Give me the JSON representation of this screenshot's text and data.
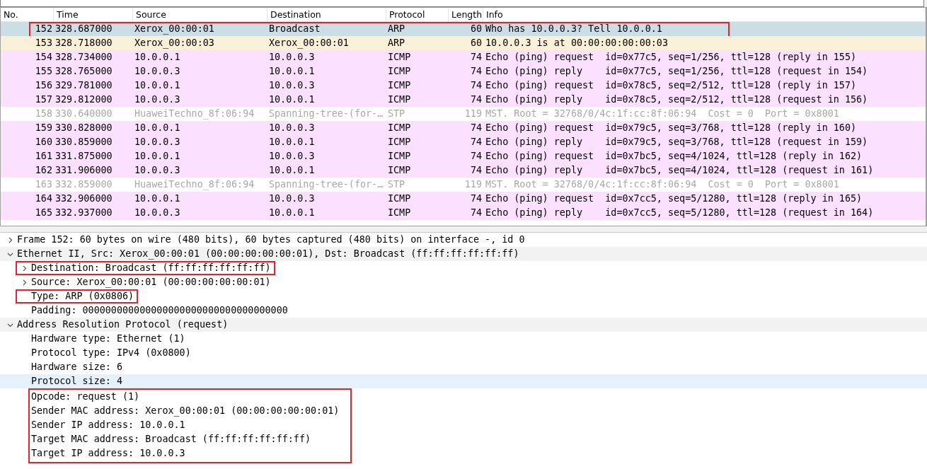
{
  "filter_bar": {
    "kind": "field"
  },
  "packet_list": {
    "columns": [
      {
        "label": "No."
      },
      {
        "label": "Time"
      },
      {
        "label": "Source"
      },
      {
        "label": "Destination"
      },
      {
        "label": "Protocol"
      },
      {
        "label": "Length"
      },
      {
        "label": "Info"
      }
    ],
    "rows": [
      {
        "no": "152",
        "time": "328.687000",
        "source": "Xerox_00:00:01",
        "destination": "Broadcast",
        "protocol": "ARP",
        "length": "60",
        "info": "Who has 10.0.0.3? Tell 10.0.0.1",
        "kind": "arp",
        "selected": true,
        "annotated": true
      },
      {
        "no": "153",
        "time": "328.718000",
        "source": "Xerox_00:00:03",
        "destination": "Xerox_00:00:01",
        "protocol": "ARP",
        "length": "60",
        "info": "10.0.0.3 is at 00:00:00:00:00:03",
        "kind": "arp",
        "selected": false,
        "annotated": false
      },
      {
        "no": "154",
        "time": "328.734000",
        "source": "10.0.0.1",
        "destination": "10.0.0.3",
        "protocol": "ICMP",
        "length": "74",
        "info": "Echo (ping) request  id=0x77c5, seq=1/256, ttl=128 (reply in 155)",
        "kind": "icmp",
        "selected": false,
        "annotated": false
      },
      {
        "no": "155",
        "time": "328.765000",
        "source": "10.0.0.3",
        "destination": "10.0.0.1",
        "protocol": "ICMP",
        "length": "74",
        "info": "Echo (ping) reply    id=0x77c5, seq=1/256, ttl=128 (request in 154)",
        "kind": "icmp",
        "selected": false,
        "annotated": false
      },
      {
        "no": "156",
        "time": "329.781000",
        "source": "10.0.0.1",
        "destination": "10.0.0.3",
        "protocol": "ICMP",
        "length": "74",
        "info": "Echo (ping) request  id=0x78c5, seq=2/512, ttl=128 (reply in 157)",
        "kind": "icmp",
        "selected": false,
        "annotated": false
      },
      {
        "no": "157",
        "time": "329.812000",
        "source": "10.0.0.3",
        "destination": "10.0.0.1",
        "protocol": "ICMP",
        "length": "74",
        "info": "Echo (ping) reply    id=0x78c5, seq=2/512, ttl=128 (request in 156)",
        "kind": "icmp",
        "selected": false,
        "annotated": false
      },
      {
        "no": "158",
        "time": "330.640000",
        "source": "HuaweiTechno_8f:06:94",
        "destination": "Spanning-tree-(for-…",
        "protocol": "STP",
        "length": "119",
        "info": "MST. Root = 32768/0/4c:1f:cc:8f:06:94  Cost = 0  Port = 0x8001",
        "kind": "stp",
        "selected": false,
        "annotated": false
      },
      {
        "no": "159",
        "time": "330.828000",
        "source": "10.0.0.1",
        "destination": "10.0.0.3",
        "protocol": "ICMP",
        "length": "74",
        "info": "Echo (ping) request  id=0x79c5, seq=3/768, ttl=128 (reply in 160)",
        "kind": "icmp",
        "selected": false,
        "annotated": false
      },
      {
        "no": "160",
        "time": "330.859000",
        "source": "10.0.0.3",
        "destination": "10.0.0.1",
        "protocol": "ICMP",
        "length": "74",
        "info": "Echo (ping) reply    id=0x79c5, seq=3/768, ttl=128 (request in 159)",
        "kind": "icmp",
        "selected": false,
        "annotated": false
      },
      {
        "no": "161",
        "time": "331.875000",
        "source": "10.0.0.1",
        "destination": "10.0.0.3",
        "protocol": "ICMP",
        "length": "74",
        "info": "Echo (ping) request  id=0x7bc5, seq=4/1024, ttl=128 (reply in 162)",
        "kind": "icmp",
        "selected": false,
        "annotated": false
      },
      {
        "no": "162",
        "time": "331.906000",
        "source": "10.0.0.3",
        "destination": "10.0.0.1",
        "protocol": "ICMP",
        "length": "74",
        "info": "Echo (ping) reply    id=0x7bc5, seq=4/1024, ttl=128 (request in 161)",
        "kind": "icmp",
        "selected": false,
        "annotated": false
      },
      {
        "no": "163",
        "time": "332.859000",
        "source": "HuaweiTechno_8f:06:94",
        "destination": "Spanning-tree-(for-…",
        "protocol": "STP",
        "length": "119",
        "info": "MST. Root = 32768/0/4c:1f:cc:8f:06:94  Cost = 0  Port = 0x8001",
        "kind": "stp",
        "selected": false,
        "annotated": false
      },
      {
        "no": "164",
        "time": "332.906000",
        "source": "10.0.0.1",
        "destination": "10.0.0.3",
        "protocol": "ICMP",
        "length": "74",
        "info": "Echo (ping) request  id=0x7cc5, seq=5/1280, ttl=128 (reply in 165)",
        "kind": "icmp",
        "selected": false,
        "annotated": false
      },
      {
        "no": "165",
        "time": "332.937000",
        "source": "10.0.0.3",
        "destination": "10.0.0.1",
        "protocol": "ICMP",
        "length": "74",
        "info": "Echo (ping) reply    id=0x7cc5, seq=5/1280, ttl=128 (request in 164)",
        "kind": "icmp",
        "selected": false,
        "annotated": false
      }
    ]
  },
  "packet_details": [
    {
      "text": "Frame 152: 60 bytes on wire (480 bits), 60 bytes captured (480 bits) on interface -, id 0",
      "expanded": false,
      "selected": false,
      "annotated": false
    },
    {
      "text": "Ethernet II, Src: Xerox_00:00:01 (00:00:00:00:00:01), Dst: Broadcast (ff:ff:ff:ff:ff:ff)",
      "expanded": true,
      "selected": false,
      "annotated": false,
      "children": [
        {
          "text": "Destination: Broadcast (ff:ff:ff:ff:ff:ff)",
          "expanded": false,
          "selected": false,
          "annotated": true
        },
        {
          "text": "Source: Xerox_00:00:01 (00:00:00:00:00:01)",
          "expanded": false,
          "selected": false,
          "annotated": false
        },
        {
          "text": "Type: ARP (0x0806)",
          "selected": false,
          "annotated": true
        },
        {
          "text": "Padding: 000000000000000000000000000000000000",
          "selected": false,
          "annotated": false
        }
      ]
    },
    {
      "text": "Address Resolution Protocol (request)",
      "expanded": true,
      "selected": false,
      "annotated": false,
      "children": [
        {
          "text": "Hardware type: Ethernet (1)",
          "selected": false,
          "annotated": false
        },
        {
          "text": "Protocol type: IPv4 (0x0800)",
          "selected": false,
          "annotated": false
        },
        {
          "text": "Hardware size: 6",
          "selected": false,
          "annotated": false
        },
        {
          "text": "Protocol size: 4",
          "selected": true,
          "annotated": false
        },
        {
          "text": "Opcode: request (1)",
          "selected": false,
          "annotated": true
        },
        {
          "text": "Sender MAC address: Xerox_00:00:01 (00:00:00:00:00:01)",
          "selected": false,
          "annotated": true
        },
        {
          "text": "Sender IP address: 10.0.0.1",
          "selected": false,
          "annotated": true
        },
        {
          "text": "Target MAC address: Broadcast (ff:ff:ff:ff:ff:ff)",
          "selected": false,
          "annotated": true
        },
        {
          "text": "Target IP address: 10.0.0.3",
          "selected": false,
          "annotated": true
        }
      ]
    }
  ]
}
